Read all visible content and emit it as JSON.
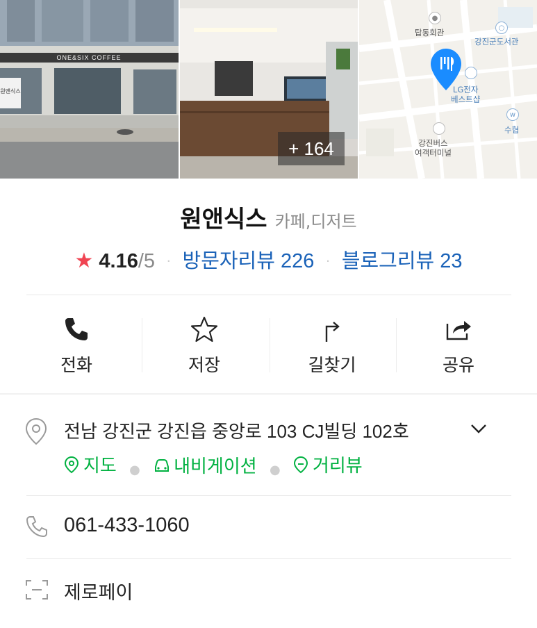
{
  "photos": {
    "storefront_sign": "ONE&SIX COFFEE",
    "banner_text": "원앤식스",
    "more_count": "+ 164"
  },
  "map": {
    "labels": {
      "landmark1": "탑동회관",
      "landmark2": "강진군도서관",
      "landmark3": "LG전자",
      "landmark3b": "베스트샵",
      "landmark4": "수협",
      "landmark5": "강진버스",
      "landmark5b": "여객터미널"
    },
    "pin_color": "#1a8cff"
  },
  "place": {
    "name": "원앤식스",
    "category": "카페,디저트",
    "rating": "4.16",
    "rating_max": "/5",
    "visitor_reviews": "방문자리뷰 226",
    "blog_reviews": "블로그리뷰 23"
  },
  "actions": [
    {
      "label": "전화",
      "icon": "phone-icon"
    },
    {
      "label": "저장",
      "icon": "star-icon"
    },
    {
      "label": "길찾기",
      "icon": "directions-icon"
    },
    {
      "label": "공유",
      "icon": "share-icon"
    }
  ],
  "info": {
    "address": "전남 강진군 강진읍 중앙로 103 CJ빌딩 102호",
    "links": [
      "지도",
      "내비게이션",
      "거리뷰"
    ],
    "phone": "061-433-1060",
    "payment": "제로페이"
  },
  "colors": {
    "accent_blue": "#1a62b8",
    "green": "#00b140",
    "star_red": "#f04452"
  }
}
